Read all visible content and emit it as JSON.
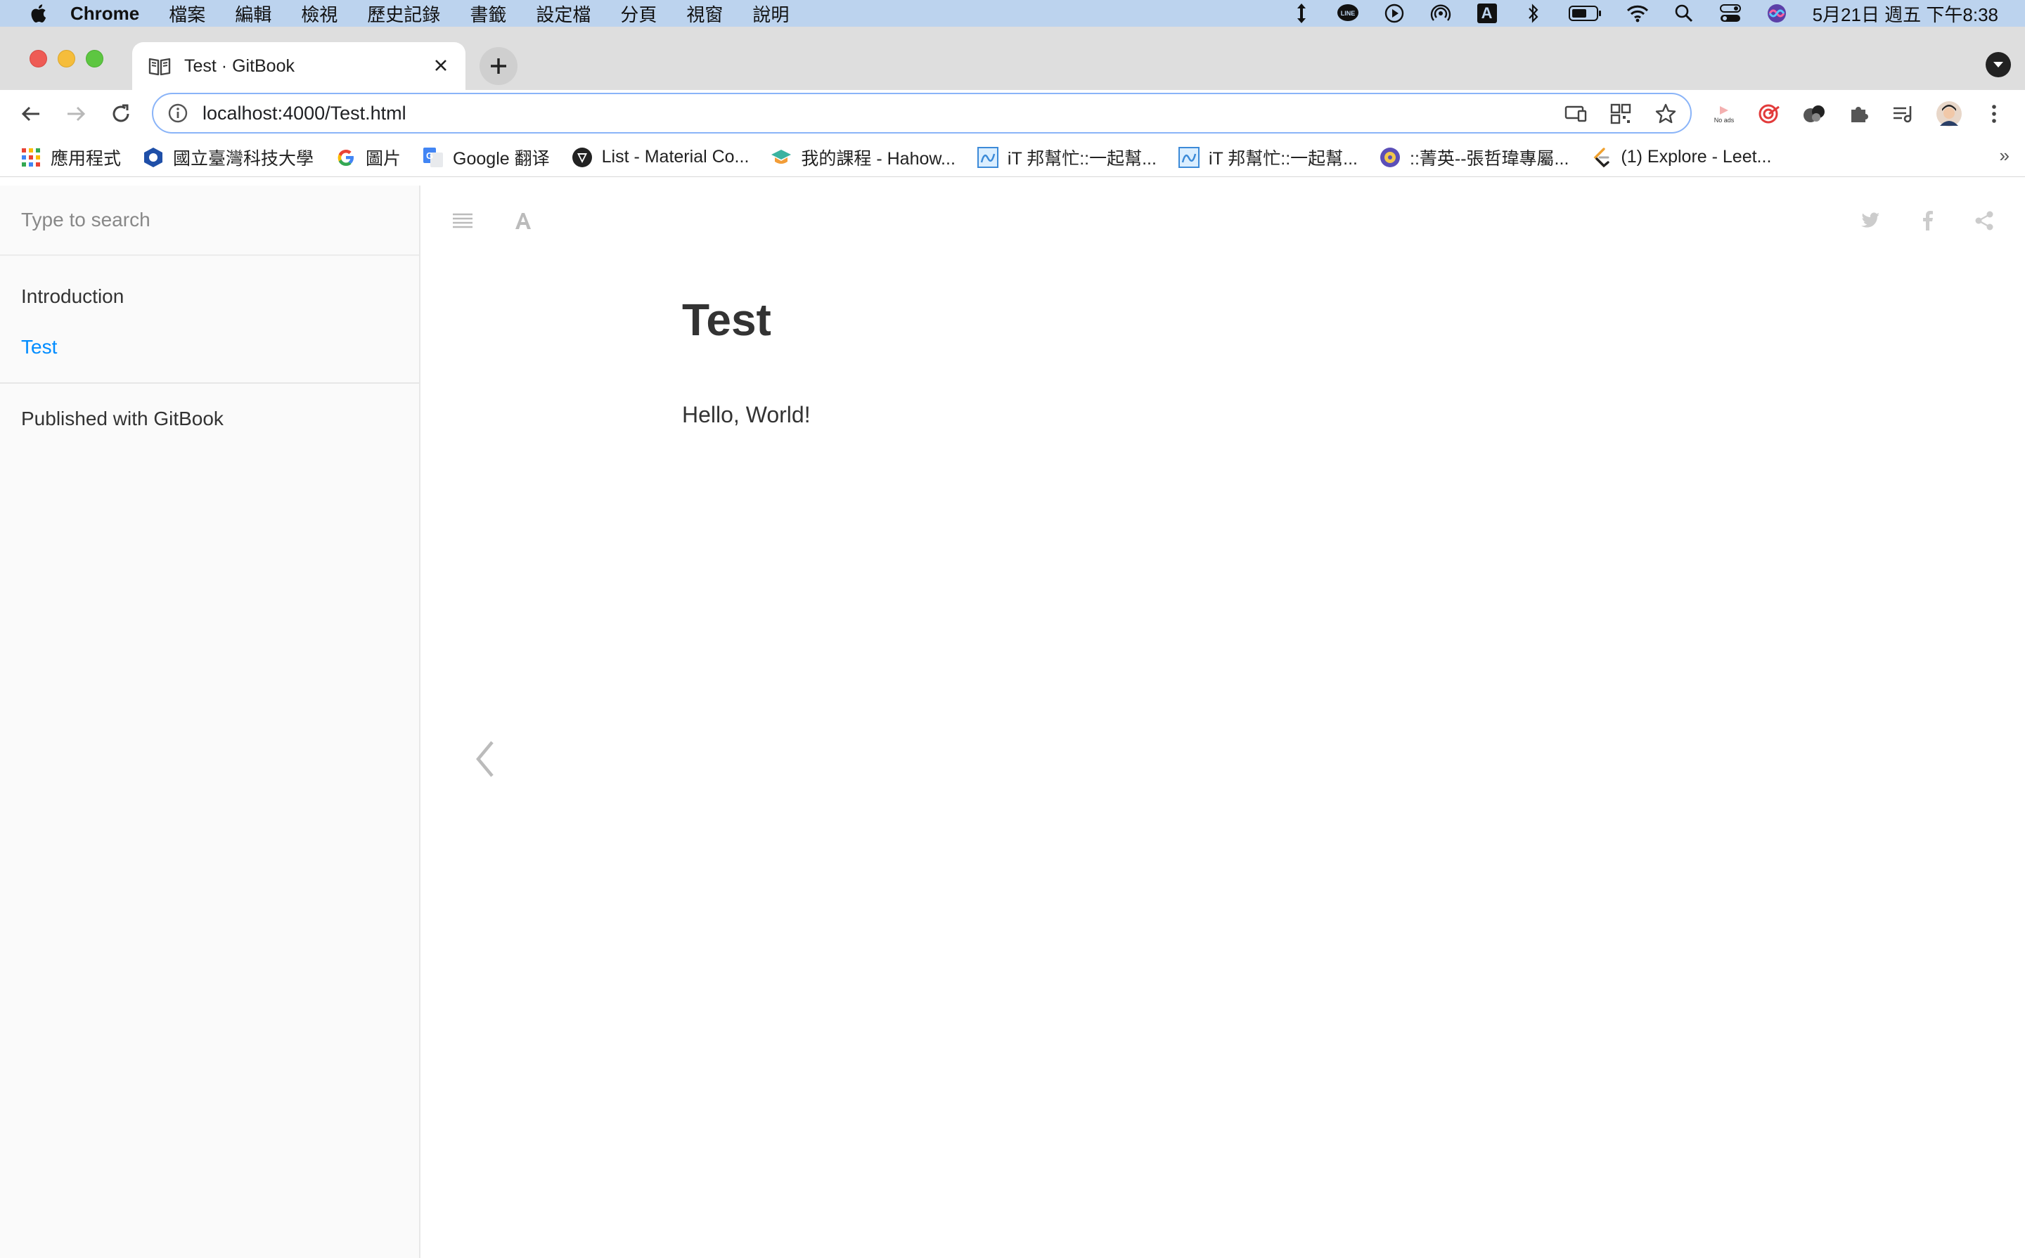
{
  "menubar": {
    "app": "Chrome",
    "items": [
      "檔案",
      "編輯",
      "檢視",
      "歷史記錄",
      "書籤",
      "設定檔",
      "分頁",
      "視窗",
      "說明"
    ],
    "status_icons": [
      "arrows-icon",
      "line-icon",
      "play-icon",
      "airdrop-icon",
      "input-a-icon",
      "bluetooth-icon",
      "battery-icon",
      "wifi-icon",
      "spotlight-icon",
      "control-center-icon",
      "siri-icon"
    ],
    "input_label": "A",
    "clock": "5月21日 週五 下午8:38"
  },
  "tab": {
    "title": "Test · GitBook"
  },
  "omnibox": {
    "url": "localhost:4000/Test.html",
    "ext_noads_label": "No ads"
  },
  "bookmarks": [
    {
      "label": "應用程式",
      "icon": "apps-grid-icon"
    },
    {
      "label": "國立臺灣科技大學",
      "icon": "ntust-icon"
    },
    {
      "label": "圖片",
      "icon": "google-icon"
    },
    {
      "label": "Google 翻译",
      "icon": "google-translate-icon"
    },
    {
      "label": "List - Material Co...",
      "icon": "material-icon"
    },
    {
      "label": "我的課程 - Hahow...",
      "icon": "hahow-icon"
    },
    {
      "label": "iT 邦幫忙::一起幫...",
      "icon": "ithome-icon"
    },
    {
      "label": "iT 邦幫忙::一起幫...",
      "icon": "ithome-icon"
    },
    {
      "label": "::菁英--張哲瑋專屬...",
      "icon": "elite-icon"
    },
    {
      "label": "(1) Explore - Leet...",
      "icon": "leetcode-icon"
    }
  ],
  "bookmarks_more": "»",
  "sidebar": {
    "search_placeholder": "Type to search",
    "items": [
      {
        "label": "Introduction",
        "active": false
      },
      {
        "label": "Test",
        "active": true
      }
    ],
    "published": "Published with GitBook"
  },
  "page": {
    "title": "Test",
    "body": "Hello, World!"
  },
  "colors": {
    "active_link": "#008cff",
    "menubar_bg": "#bcd3ee",
    "sidebar_bg": "#fafafa"
  }
}
